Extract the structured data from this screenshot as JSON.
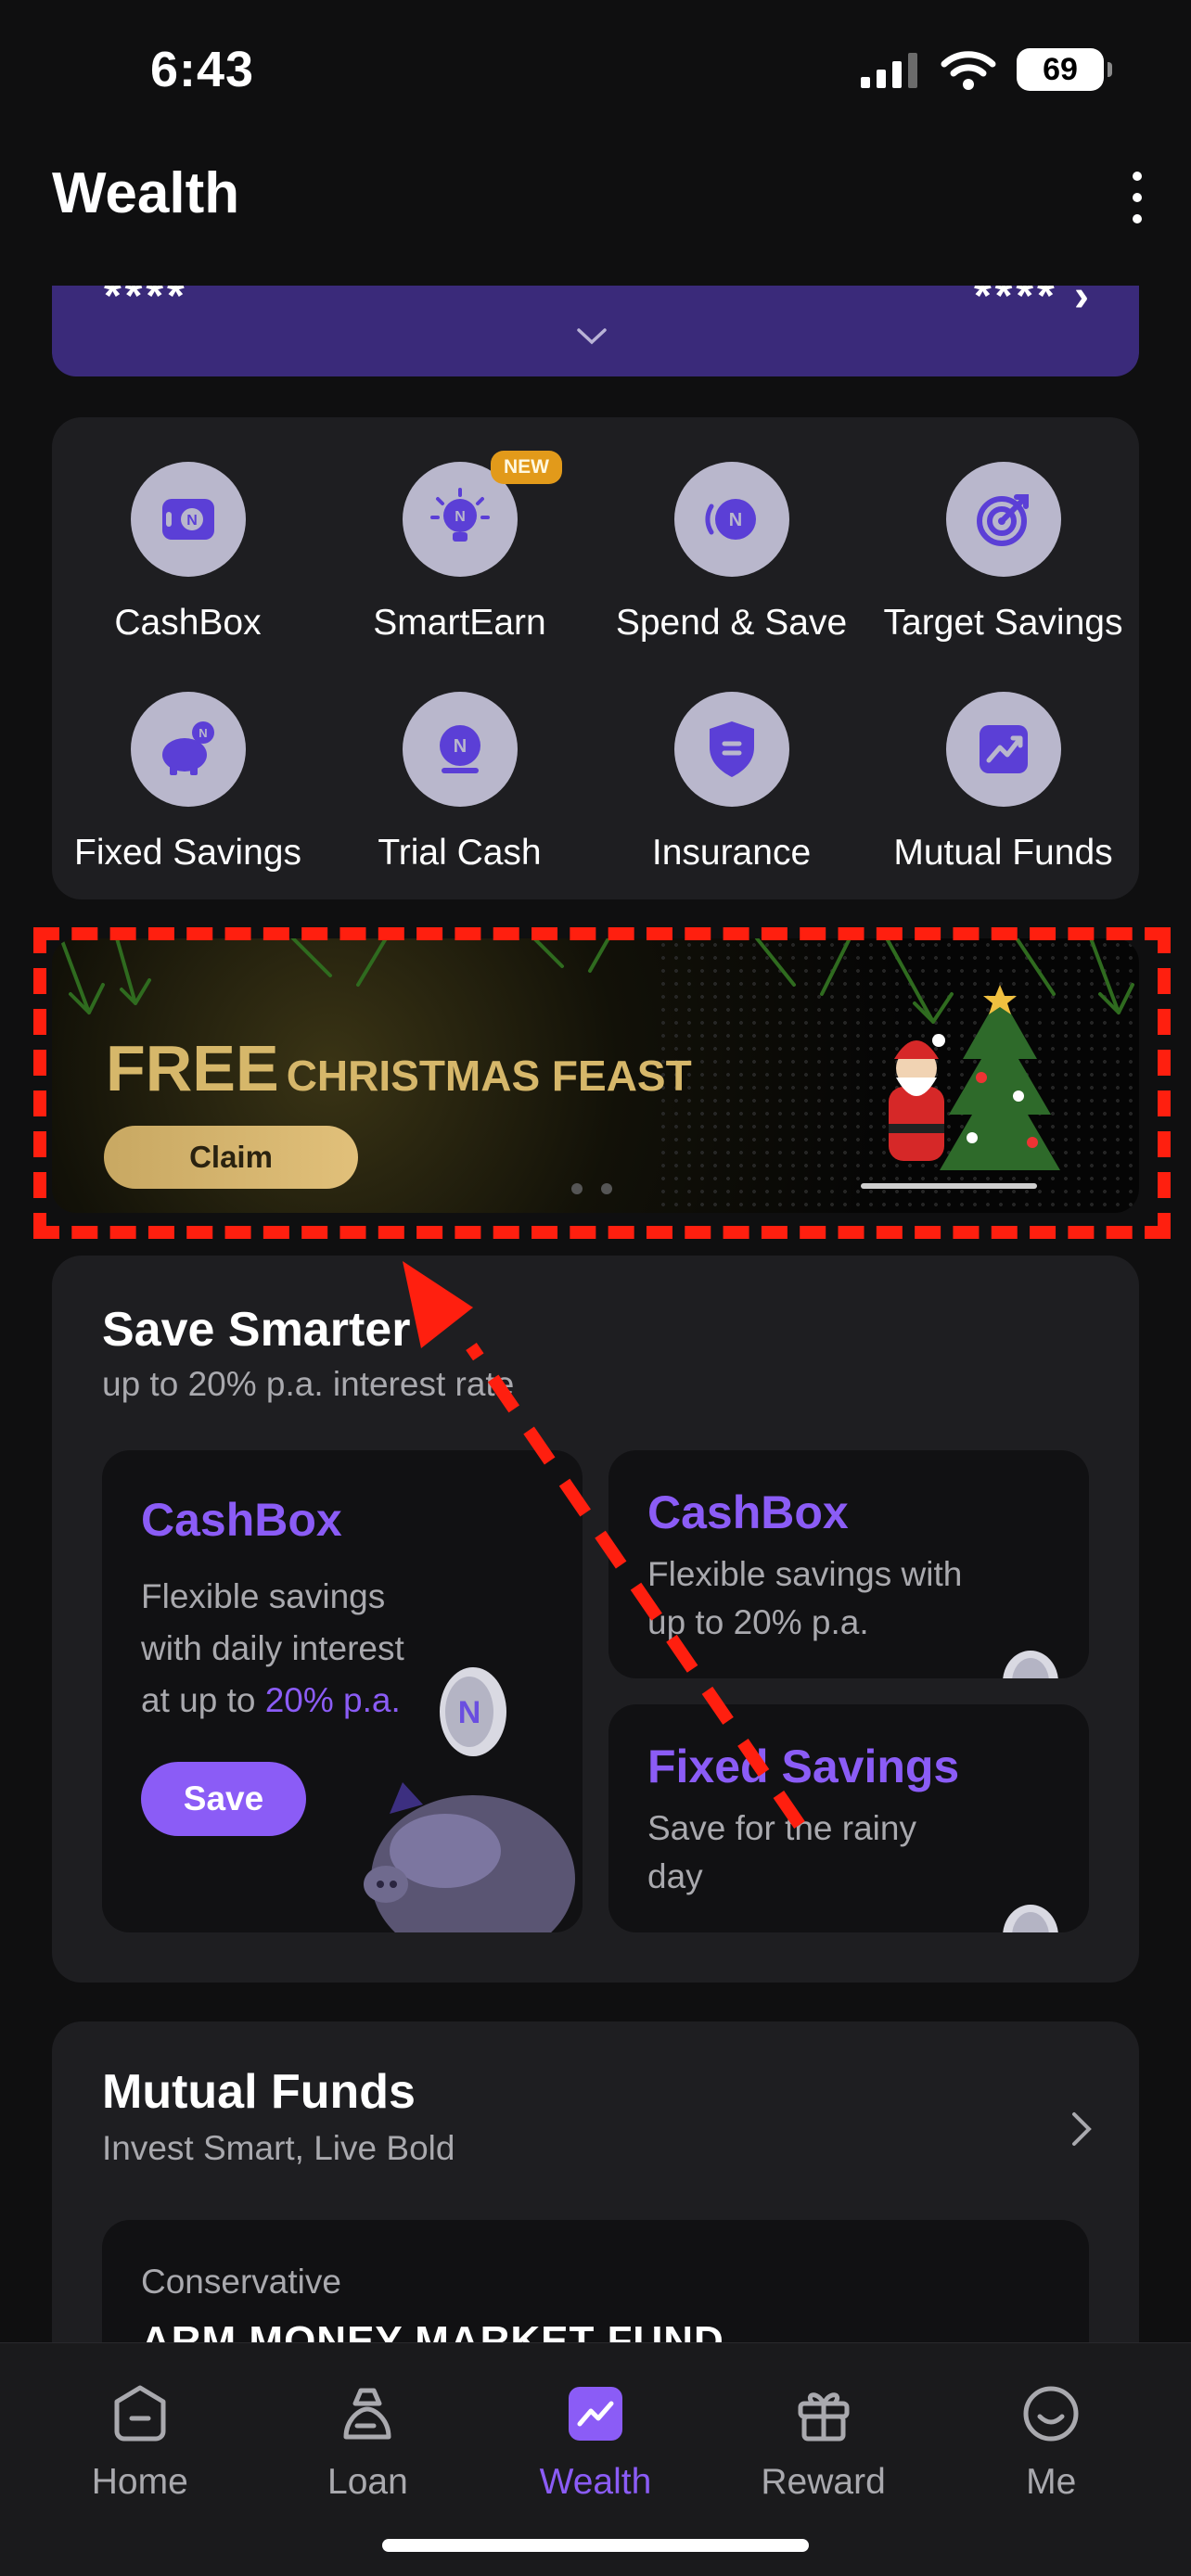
{
  "status_bar": {
    "time": "6:43",
    "battery": "69"
  },
  "header": {
    "title": "Wealth",
    "menu_icon": "more-vertical-icon"
  },
  "balance": {
    "left_masked": "****",
    "right_masked": "****"
  },
  "quick_actions": [
    {
      "label": "CashBox",
      "icon": "cashbox-icon"
    },
    {
      "label": "SmartEarn",
      "icon": "lightbulb-icon",
      "badge": "NEW"
    },
    {
      "label": "Spend & Save",
      "icon": "spend-save-icon"
    },
    {
      "label": "Target Savings",
      "icon": "target-icon"
    },
    {
      "label": "Fixed Savings",
      "icon": "piggy-bank-icon"
    },
    {
      "label": "Trial Cash",
      "icon": "trial-cash-icon"
    },
    {
      "label": "Insurance",
      "icon": "shield-icon"
    },
    {
      "label": "Mutual Funds",
      "icon": "chart-up-icon"
    }
  ],
  "banner": {
    "title_big": "FREE",
    "title_rest": "CHRISTMAS FEAST",
    "button": "Claim"
  },
  "save_smarter": {
    "title": "Save Smarter",
    "subtitle": "up to 20% p.a. interest rate",
    "big_tile": {
      "title": "CashBox",
      "desc_line1": "Flexible savings",
      "desc_line2": "with daily interest",
      "desc_line3_prefix": "at up to ",
      "desc_line3_accent": "20% p.a.",
      "button": "Save"
    },
    "tile_cashbox": {
      "title": "CashBox",
      "desc_line1": "Flexible savings with",
      "desc_line2": "up to 20% p.a."
    },
    "tile_fixed": {
      "title": "Fixed Savings",
      "desc_line1": "Save for the rainy",
      "desc_line2": "day"
    }
  },
  "mutual_funds": {
    "title": "Mutual Funds",
    "subtitle": "Invest Smart, Live Bold",
    "fund": {
      "risk": "Conservative",
      "name": "ARM MONEY MARKET FUND"
    }
  },
  "bottom_nav": [
    {
      "label": "Home",
      "icon": "home-icon"
    },
    {
      "label": "Loan",
      "icon": "loan-icon"
    },
    {
      "label": "Wealth",
      "icon": "wealth-icon",
      "active": true
    },
    {
      "label": "Reward",
      "icon": "gift-icon"
    },
    {
      "label": "Me",
      "icon": "smile-icon"
    }
  ],
  "colors": {
    "accent": "#8b5cf6",
    "background": "#0f0f10",
    "card": "#1e1e21",
    "highlight": "#ff1f0f",
    "gold": "#d6b76a"
  }
}
